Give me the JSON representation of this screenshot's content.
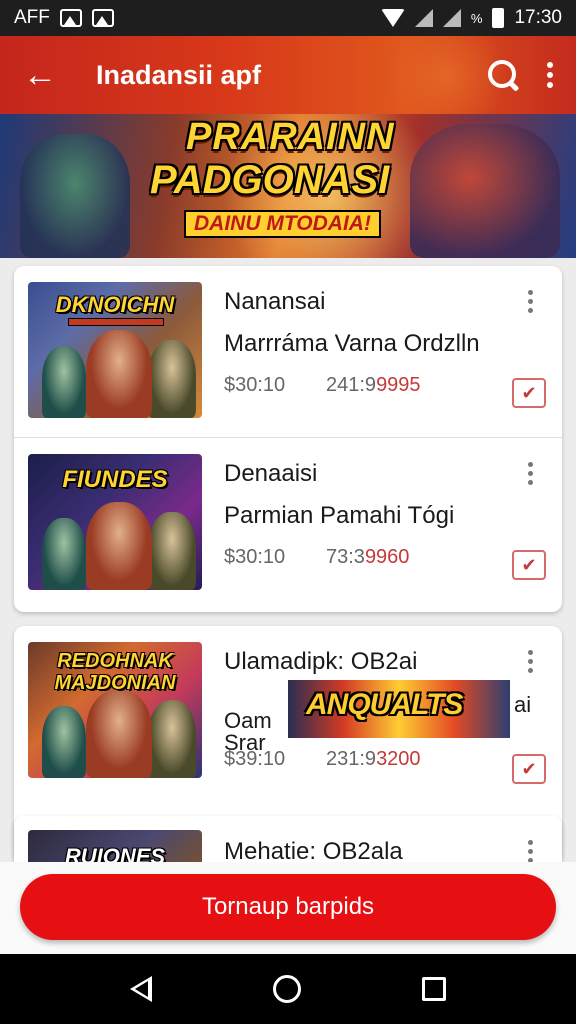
{
  "status_bar": {
    "carrier": "AFF",
    "time": "17:30",
    "battery_pct": "%"
  },
  "header": {
    "title": "Inadansii apf",
    "back_icon": "arrow-left-icon",
    "search_icon": "search-icon",
    "menu_icon": "more-vert-icon"
  },
  "banner": {
    "line1": "PRARAINN",
    "line2": "PADGONASI",
    "line3": "DAINU MTODAIA!"
  },
  "items": [
    {
      "thumb_title": "DKNOICHN",
      "name": "Nanansai",
      "description": "Marrráma Varna Ordzlln",
      "price": "$30:10",
      "code_prefix": "241:9",
      "code_highlight": "9995",
      "checked": true
    },
    {
      "thumb_title": "FIUNDES",
      "name": "Denaaisi",
      "description": "Parmian Pamahi Tógi",
      "price": "$30:10",
      "code_prefix": "73:3",
      "code_highlight": "9960",
      "checked": true
    },
    {
      "thumb_title": "REDOHNAK MAJDONIAN",
      "name": "Ulamadipk: OB2ai",
      "description": "Oam",
      "description_2": "Srar",
      "overlay_tail": "ai",
      "overlay_text": "ANQUALTS",
      "price": "$39:10",
      "code_prefix": "231:9",
      "code_highlight": "3200",
      "checked": true
    },
    {
      "thumb_title": "RUIONES",
      "name": "Mehatie: OB2ala"
    }
  ],
  "cta": {
    "label": "Tornaup barpids"
  },
  "colors": {
    "accent": "#e60f12",
    "header": "#d8391a",
    "check": "#c73a3a"
  }
}
